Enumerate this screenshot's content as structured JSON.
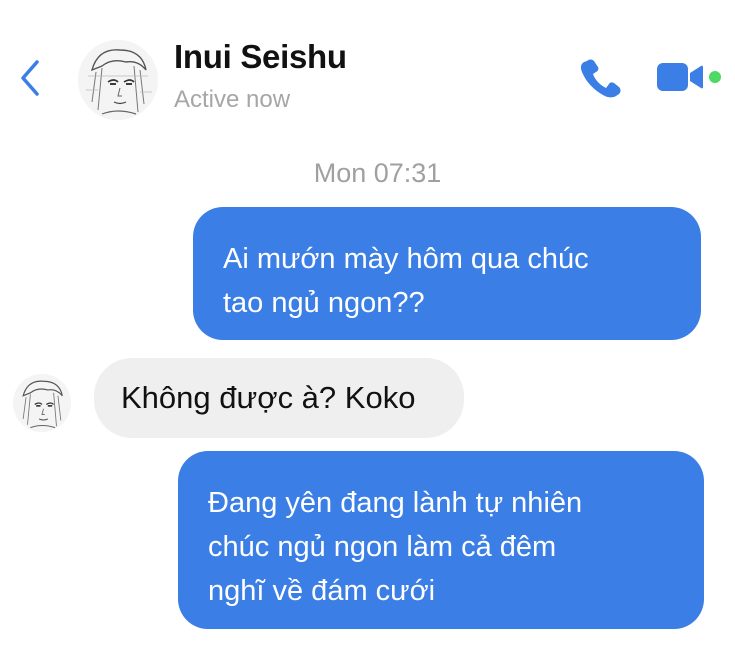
{
  "header": {
    "contact_name": "Inui Seishu",
    "status": "Active now",
    "back_icon": "chevron-left-icon",
    "call_icon": "phone-icon",
    "video_icon": "video-camera-icon",
    "online_indicator_color": "#4cd964",
    "accent_color": "#3a7ee6"
  },
  "conversation": {
    "timestamp": "Mon 07:31",
    "messages": [
      {
        "direction": "outgoing",
        "text": "Ai mướn mày hôm qua chúc\ntao ngủ ngon??"
      },
      {
        "direction": "incoming",
        "text": "Không được à? Koko"
      },
      {
        "direction": "outgoing",
        "text": "Đang yên đang lành tự nhiên\nchúc ngủ ngon làm cả đêm\nnghĩ về đám cưới"
      }
    ]
  }
}
